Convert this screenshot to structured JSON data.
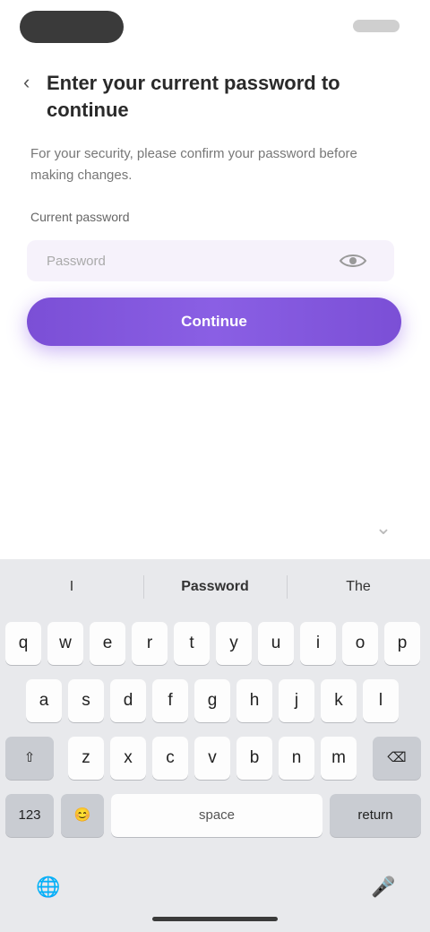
{
  "page": {
    "title": "Enter your current password to continue",
    "description": "For your security, please confirm your password before making changes.",
    "field_label": "Current password",
    "password_placeholder": "Password",
    "primary_button": "Continue"
  },
  "keyboard": {
    "suggestions": [
      "I",
      "Password",
      "The"
    ],
    "rows": [
      [
        "q",
        "w",
        "e",
        "r",
        "t",
        "y",
        "u",
        "i",
        "o",
        "p"
      ],
      [
        "a",
        "s",
        "d",
        "f",
        "g",
        "h",
        "j",
        "k",
        "l"
      ],
      [
        "⇧",
        "z",
        "x",
        "c",
        "v",
        "b",
        "n",
        "m",
        "⌫"
      ],
      [
        "123",
        "😊",
        "space",
        "return"
      ]
    ]
  }
}
